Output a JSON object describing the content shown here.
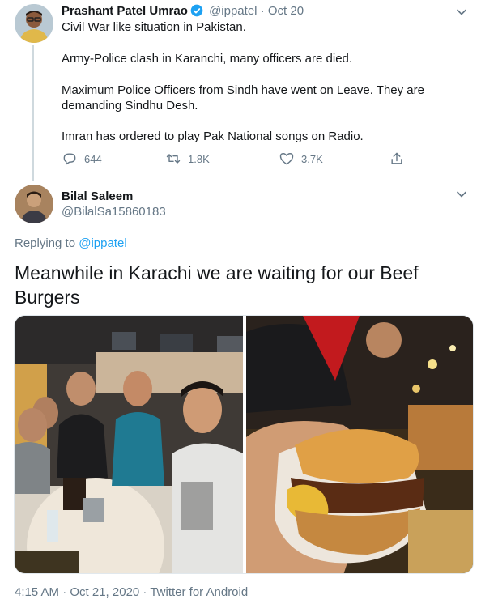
{
  "parent_tweet": {
    "author_name": "Prashant Patel Umrao",
    "handle": "@ippatel",
    "separator": "·",
    "date": "Oct 20",
    "lines": [
      "Civil War like situation in Pakistan.",
      "Army-Police clash in Karanchi, many officers are died.",
      "Maximum Police Officers from Sindh have went on Leave. They are",
      "demanding Sindhu Desh.",
      "Imran has ordered to play Pak National songs on Radio."
    ],
    "replies": "644",
    "retweets": "1.8K",
    "likes": "3.7K"
  },
  "reply_tweet": {
    "author_name": "Bilal Saleem",
    "handle": "@BilalSa15860183",
    "replying_prefix": "Replying to",
    "replying_to": "@ippatel",
    "text": "Meanwhile in Karachi we are waiting for our Beef Burgers",
    "footer": "4:15 AM · Oct 21, 2020 · Twitter for Android"
  },
  "icons": {
    "verified": "verified-badge-icon",
    "caret": "chevron-down-icon",
    "reply": "reply-icon",
    "retweet": "retweet-icon",
    "like": "heart-icon",
    "share": "share-icon"
  },
  "colors": {
    "accent": "#1da1f2",
    "secondary_text": "#657786",
    "primary_text": "#14171a"
  }
}
